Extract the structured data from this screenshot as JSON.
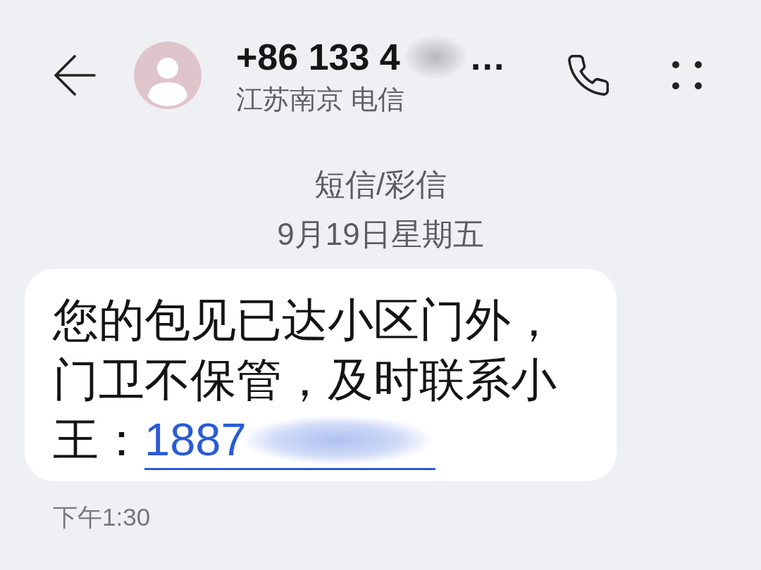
{
  "header": {
    "number": "+86 133 4",
    "number_redacted": true,
    "number_ellipsis": "…",
    "carrier": "江苏南京 电信"
  },
  "conversation": {
    "channel": "短信/彩信",
    "date": "9月19日星期五"
  },
  "messages": [
    {
      "text": "您的包见已达小区门外，门卫不保管，及时联系小王：",
      "link": "1887",
      "link_redacted": true,
      "time": "下午1:30"
    }
  ]
}
